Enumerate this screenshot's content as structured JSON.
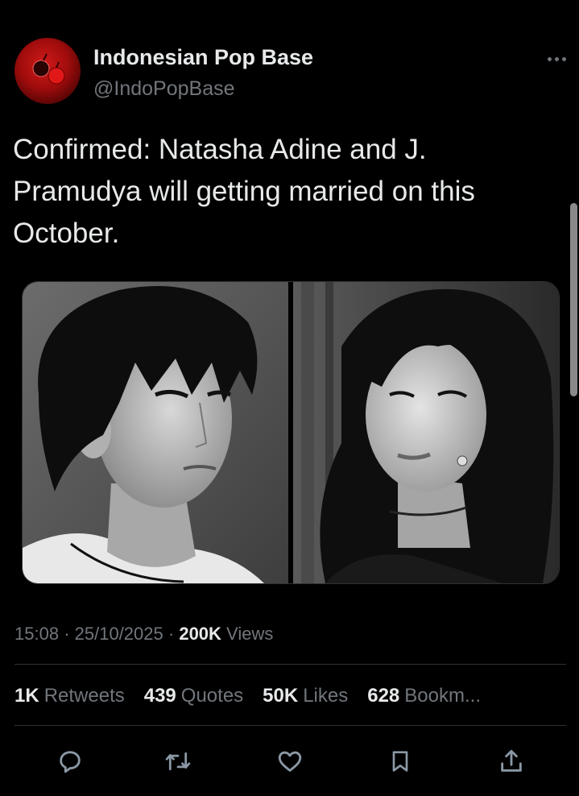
{
  "author": {
    "display_name": "Indonesian Pop Base",
    "handle": "@IndoPopBase",
    "avatar_icon": "red-fruit-logo-icon"
  },
  "tweet": {
    "text": "Confirmed: Natasha Adine and J. Pramudya will getting married on this October.",
    "media": [
      {
        "alt_icon": "man-portrait-photo"
      },
      {
        "alt_icon": "woman-portrait-photo"
      }
    ]
  },
  "meta": {
    "time": "15:08",
    "date": "25/10/2025",
    "views_count": "200K",
    "views_label": "Views",
    "separator": "·"
  },
  "stats": [
    {
      "value": "1K",
      "label": "Retweets"
    },
    {
      "value": "439",
      "label": "Quotes"
    },
    {
      "value": "50K",
      "label": "Likes"
    },
    {
      "value": "628",
      "label": "Bookm..."
    }
  ],
  "actions": [
    "reply-icon",
    "retweet-icon",
    "like-icon",
    "bookmark-icon",
    "share-icon"
  ],
  "colors": {
    "background": "#000000",
    "text": "#e7e9ea",
    "muted": "#71767b",
    "divider": "#2f3336",
    "avatar": "#c01414"
  }
}
